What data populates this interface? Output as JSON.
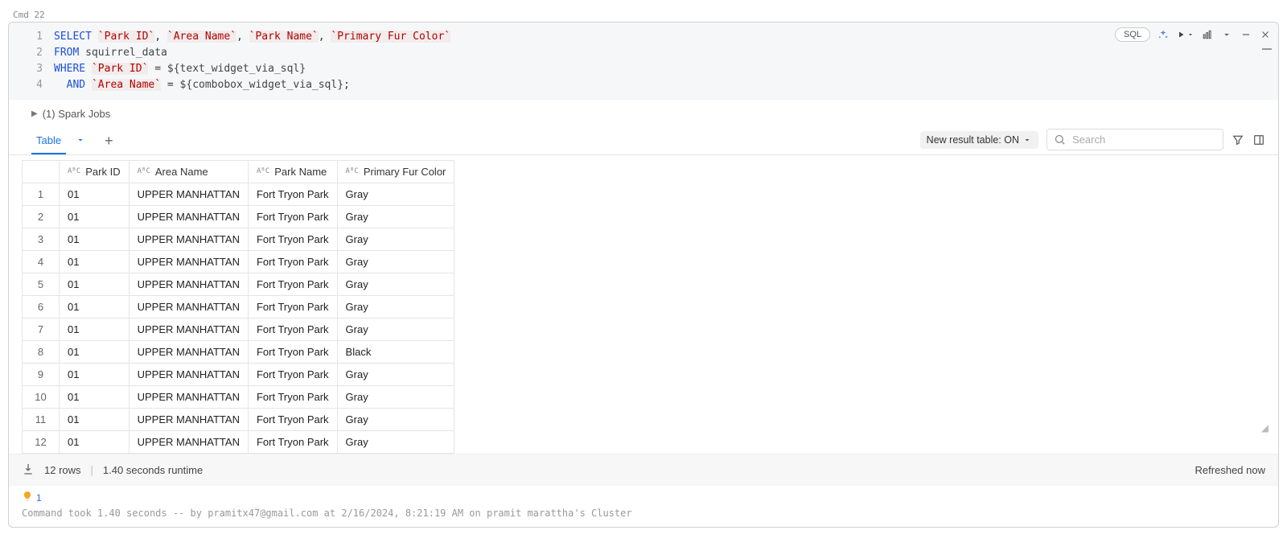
{
  "cmd_label": "Cmd 22",
  "toolbar": {
    "sql_pill": "SQL"
  },
  "code": {
    "line_numbers": [
      "1",
      "2",
      "3",
      "4"
    ],
    "l1_kw": "SELECT",
    "l1_id1": "`Park ID`",
    "l1_id2": "`Area Name`",
    "l1_id3": "`Park Name`",
    "l1_id4": "`Primary Fur Color`",
    "l2_kw": "FROM",
    "l2_tbl": "squirrel_data",
    "l3_kw": "WHERE",
    "l3_id": "`Park ID`",
    "l3_var": "${text_widget_via_sql}",
    "l4_kw": "AND",
    "l4_id": "`Area Name`",
    "l4_var": "${combobox_widget_via_sql}",
    "eq": " = ",
    "comma": ", ",
    "semi": ";"
  },
  "spark_jobs_label": "(1) Spark Jobs",
  "tabs": {
    "table_label": "Table",
    "result_toggle": "New result table: ON",
    "search_placeholder": "Search"
  },
  "columns": {
    "c1": "Park ID",
    "c2": "Area Name",
    "c3": "Park Name",
    "c4": "Primary Fur Color",
    "type_label": "AᴮC"
  },
  "rows": [
    {
      "n": "1",
      "park_id": "01",
      "area": "UPPER MANHATTAN",
      "park": "Fort Tryon Park",
      "fur": "Gray"
    },
    {
      "n": "2",
      "park_id": "01",
      "area": "UPPER MANHATTAN",
      "park": "Fort Tryon Park",
      "fur": "Gray"
    },
    {
      "n": "3",
      "park_id": "01",
      "area": "UPPER MANHATTAN",
      "park": "Fort Tryon Park",
      "fur": "Gray"
    },
    {
      "n": "4",
      "park_id": "01",
      "area": "UPPER MANHATTAN",
      "park": "Fort Tryon Park",
      "fur": "Gray"
    },
    {
      "n": "5",
      "park_id": "01",
      "area": "UPPER MANHATTAN",
      "park": "Fort Tryon Park",
      "fur": "Gray"
    },
    {
      "n": "6",
      "park_id": "01",
      "area": "UPPER MANHATTAN",
      "park": "Fort Tryon Park",
      "fur": "Gray"
    },
    {
      "n": "7",
      "park_id": "01",
      "area": "UPPER MANHATTAN",
      "park": "Fort Tryon Park",
      "fur": "Gray"
    },
    {
      "n": "8",
      "park_id": "01",
      "area": "UPPER MANHATTAN",
      "park": "Fort Tryon Park",
      "fur": "Black"
    },
    {
      "n": "9",
      "park_id": "01",
      "area": "UPPER MANHATTAN",
      "park": "Fort Tryon Park",
      "fur": "Gray"
    },
    {
      "n": "10",
      "park_id": "01",
      "area": "UPPER MANHATTAN",
      "park": "Fort Tryon Park",
      "fur": "Gray"
    },
    {
      "n": "11",
      "park_id": "01",
      "area": "UPPER MANHATTAN",
      "park": "Fort Tryon Park",
      "fur": "Gray"
    },
    {
      "n": "12",
      "park_id": "01",
      "area": "UPPER MANHATTAN",
      "park": "Fort Tryon Park",
      "fur": "Gray"
    }
  ],
  "footer": {
    "row_count": "12 rows",
    "runtime": "1.40 seconds runtime",
    "refreshed": "Refreshed now"
  },
  "hint_count": "1",
  "cmd_timing": "Command took 1.40 seconds -- by pramitx47@gmail.com at 2/16/2024, 8:21:19 AM on pramit marattha's Cluster"
}
